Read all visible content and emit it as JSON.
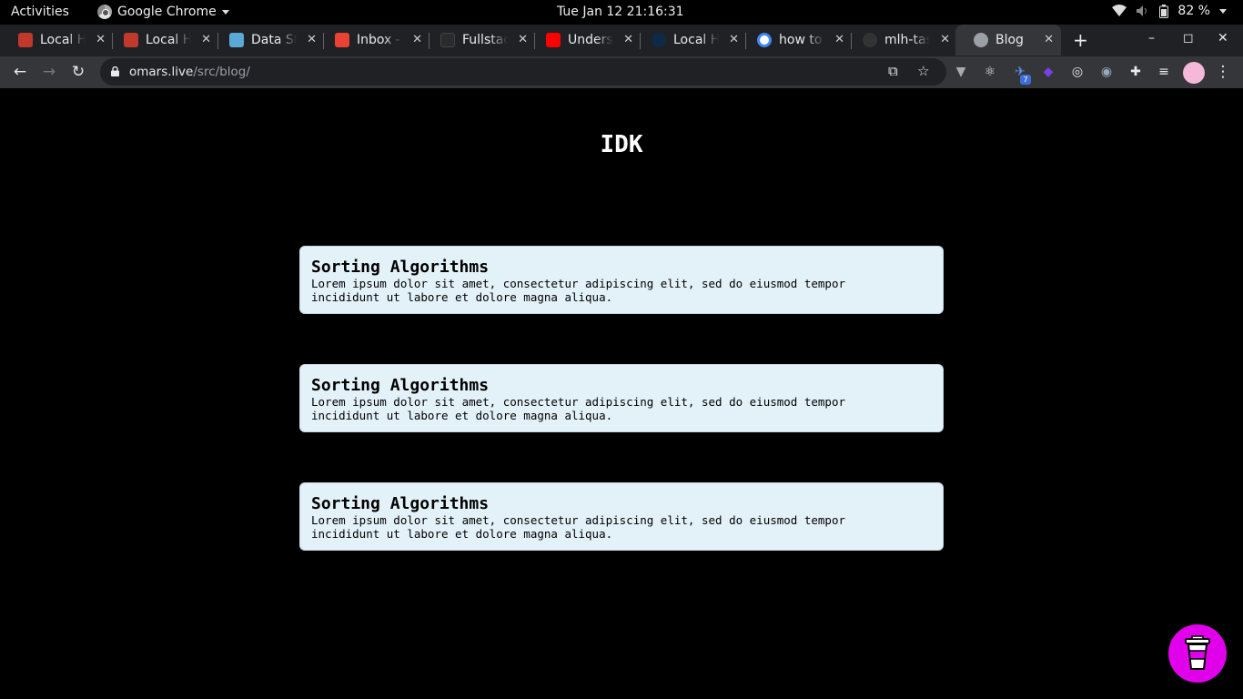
{
  "system_bar": {
    "activities": "Activities",
    "app_name": "Google Chrome",
    "clock": "Tue Jan 12  21:16:31",
    "battery": "82 %"
  },
  "tabs": [
    {
      "title": "Local Hack Day",
      "favicon_color": "#c0392b"
    },
    {
      "title": "Local Hack Day",
      "favicon_color": "#c0392b"
    },
    {
      "title": "Data Structures",
      "favicon_color": "#5aa9d6"
    },
    {
      "title": "Inbox - Gmail",
      "favicon_color": "#ea4335"
    },
    {
      "title": "Fullstack",
      "favicon_color": "#2b2b2b"
    },
    {
      "title": "Understanding",
      "favicon_color": "#ff0000"
    },
    {
      "title": "Local Hack Day",
      "favicon_color": "#0f2a47"
    },
    {
      "title": "how to",
      "favicon_color": "#4285f4"
    },
    {
      "title": "mlh-tasks",
      "favicon_color": "#333333"
    },
    {
      "title": "Blog",
      "favicon_color": "#9aa0a6",
      "active": true
    }
  ],
  "address_bar": {
    "domain": "omars.live",
    "path": "/src/blog/"
  },
  "extension_badge": "7",
  "page": {
    "title": "IDK",
    "posts": [
      {
        "title": "Sorting Algorithms",
        "excerpt": "Lorem ipsum dolor sit amet, consectetur adipiscing elit, sed do eiusmod tempor incididunt ut labore et dolore magna aliqua."
      },
      {
        "title": "Sorting Algorithms",
        "excerpt": "Lorem ipsum dolor sit amet, consectetur adipiscing elit, sed do eiusmod tempor incididunt ut labore et dolore magna aliqua."
      },
      {
        "title": "Sorting Algorithms",
        "excerpt": "Lorem ipsum dolor sit amet, consectetur adipiscing elit, sed do eiusmod tempor incididunt ut labore et dolore magna aliqua."
      }
    ]
  },
  "colors": {
    "card_bg": "#e3f1f8",
    "fab_bg": "#e000ea",
    "page_bg": "#000000"
  }
}
